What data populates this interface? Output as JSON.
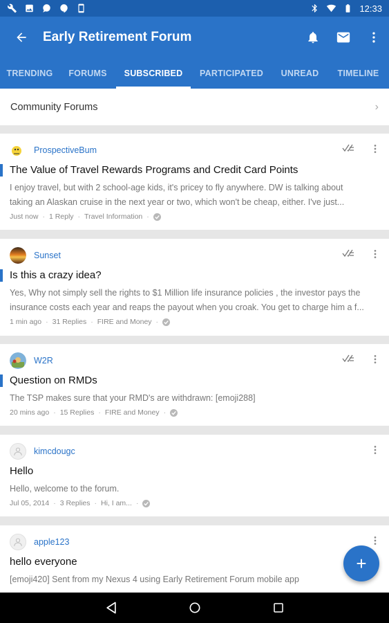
{
  "status_bar": {
    "time": "12:33",
    "left_icons": [
      "wrench-icon",
      "image-icon",
      "chat-icon",
      "hangouts-icon",
      "device-icon"
    ],
    "right_icons": [
      "bluetooth-icon",
      "wifi-icon",
      "battery-icon"
    ]
  },
  "app_bar": {
    "title": "Early Retirement Forum",
    "actions": [
      "bell-icon",
      "mail-icon",
      "overflow-icon"
    ]
  },
  "tabs": [
    {
      "label": "TRENDING",
      "active": false
    },
    {
      "label": "FORUMS",
      "active": false
    },
    {
      "label": "SUBSCRIBED",
      "active": true
    },
    {
      "label": "PARTICIPATED",
      "active": false
    },
    {
      "label": "UNREAD",
      "active": false
    },
    {
      "label": "TIMELINE",
      "active": false
    }
  ],
  "community": {
    "label": "Community Forums"
  },
  "topics": [
    {
      "user": "ProspectiveBum",
      "title": "The Value of Travel Rewards Programs and Credit Card Points",
      "excerpt": [
        "I enjoy travel, but with 2 school-age kids, it's pricey to fly anywhere. DW is talking about",
        "taking an Alaskan cruise in the next year or two, which won't be cheap, either. I've just..."
      ],
      "time": "Just now",
      "replies": "1 Reply",
      "forum": "Travel Information",
      "unread": true
    },
    {
      "user": "Sunset",
      "title": "Is this a crazy idea?",
      "excerpt": [
        "Yes, Why not simply sell the rights to $1 Million life insurance policies , the investor pays the",
        "insurance costs each year and reaps the payout when you croak. You get to charge him a f..."
      ],
      "time": "1 min ago",
      "replies": "31 Replies",
      "forum": "FIRE and Money",
      "unread": true
    },
    {
      "user": "W2R",
      "title": "Question on RMDs",
      "excerpt": [
        "The TSP makes sure that your RMD's are withdrawn: [emoji288]"
      ],
      "time": "20 mins ago",
      "replies": "15 Replies",
      "forum": "FIRE and Money",
      "unread": true
    },
    {
      "user": "kimcdougc",
      "title": "Hello",
      "excerpt": [
        "Hello, welcome to the forum."
      ],
      "time": "Jul 05, 2014",
      "replies": "3 Replies",
      "forum": "Hi, I am...",
      "unread": false
    },
    {
      "user": "apple123",
      "title": "hello everyone",
      "excerpt": [
        "[emoji420] Sent from my Nexus 4 using Early Retirement Forum mobile app"
      ],
      "unread": false
    }
  ],
  "fab": {
    "label": "+"
  },
  "nav": [
    "back-nav-icon",
    "home-nav-icon",
    "recents-nav-icon"
  ]
}
